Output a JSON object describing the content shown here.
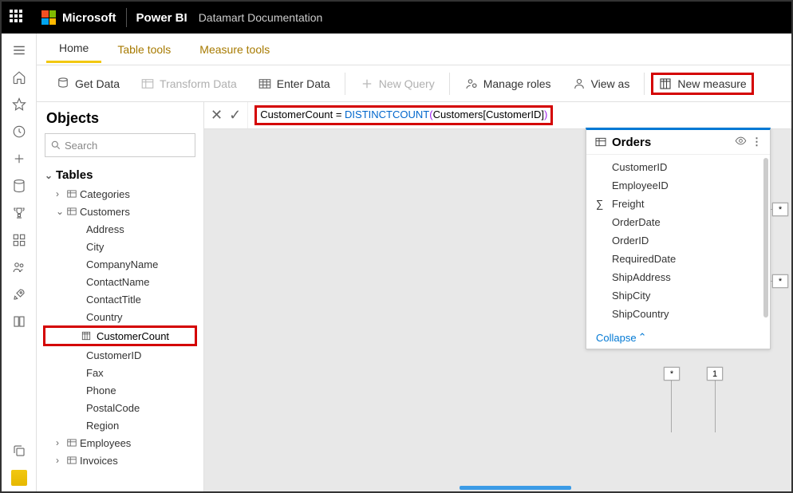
{
  "topbar": {
    "brand": "Microsoft",
    "app": "Power BI",
    "subtitle": "Datamart Documentation"
  },
  "tabs": {
    "home": "Home",
    "table_tools": "Table tools",
    "measure_tools": "Measure tools"
  },
  "toolbar": {
    "get_data": "Get Data",
    "transform": "Transform Data",
    "enter_data": "Enter Data",
    "new_query": "New Query",
    "manage_roles": "Manage roles",
    "view_as": "View as",
    "new_measure": "New measure"
  },
  "formula": {
    "prefix": "CustomerCount = ",
    "func": "DISTINCTCOUNT",
    "open": "(",
    "arg": "Customers[CustomerID]",
    "close": ")"
  },
  "sidebar": {
    "title": "Objects",
    "search": "Search",
    "section": "Tables",
    "tables": {
      "categories": "Categories",
      "customers": "Customers",
      "employees": "Employees",
      "invoices": "Invoices"
    },
    "customer_fields": {
      "address": "Address",
      "city": "City",
      "company": "CompanyName",
      "contact_name": "ContactName",
      "contact_title": "ContactTitle",
      "country": "Country",
      "customer_count": "CustomerCount",
      "customer_id": "CustomerID",
      "fax": "Fax",
      "phone": "Phone",
      "postal": "PostalCode",
      "region": "Region"
    }
  },
  "orders_card": {
    "title": "Orders",
    "collapse": "Collapse",
    "fields": {
      "customer_id": "CustomerID",
      "employee_id": "EmployeeID",
      "freight": "Freight",
      "order_date": "OrderDate",
      "order_id": "OrderID",
      "required_date": "RequiredDate",
      "ship_address": "ShipAddress",
      "ship_city": "ShipCity",
      "ship_country": "ShipCountry"
    }
  },
  "markers": {
    "star1": "*",
    "star2": "*",
    "star3": "*",
    "one": "1"
  }
}
